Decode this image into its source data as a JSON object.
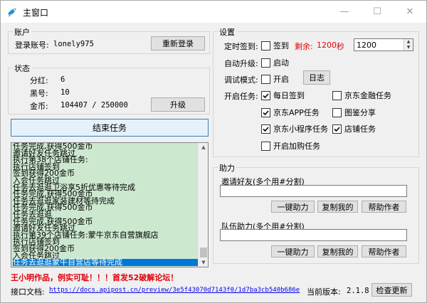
{
  "window": {
    "title": "主窗口",
    "minimize": "—",
    "maximize": "☐",
    "close": "✕"
  },
  "account": {
    "group_title": "账户",
    "login_label": "登录账号:",
    "login_value": "lonely975",
    "relogin_button": "重新登录"
  },
  "status": {
    "group_title": "状态",
    "dividend_label": "分红:",
    "dividend_value": "6",
    "blackno_label": "黑号:",
    "blackno_value": "10",
    "gold_label": "金币:",
    "gold_value": "104407 / 250000",
    "upgrade_button": "升级"
  },
  "end_task_button": "结束任务",
  "log": {
    "lines": [
      "任务完成,获得500金币",
      "邀请好友任务跳过",
      "执行第38个店铺任务:",
      "执行店铺签到",
      "签到获得200金币",
      "入会任务跳过",
      "任务去逛逛卫浴享5折优惠等待完成",
      "任务完成,获得500金币",
      "任务去逛逛家装建材等待完成",
      "任务完成,获得500金币",
      "任务去逛逛",
      "任务完成,获得500金币",
      "邀请好友任务跳过",
      "执行第39个店铺任务:蒙牛京东自营旗舰店",
      "执行店铺签到",
      "签到获得200金币",
      "入会任务跳过",
      "任务去逛逛蒙牛自营店等待完成"
    ],
    "selected_index": 17
  },
  "settings": {
    "group_title": "设置",
    "timer_label": "定时签到:",
    "timer_checkbox": "签到",
    "remaining_label": "剩余:",
    "remaining_value": "1200",
    "remaining_unit": "秒",
    "timer_input": "1200",
    "autoupgrade_label": "自动升级:",
    "autoupgrade_checkbox": "启动",
    "debug_label": "调试模式:",
    "debug_checkbox": "开启",
    "log_button": "日志",
    "tasks_label": "开启任务:",
    "tasks": [
      {
        "label": "每日签到",
        "checked": true
      },
      {
        "label": "京东金融任务",
        "checked": false
      },
      {
        "label": "京东APP任务",
        "checked": true
      },
      {
        "label": "图鉴分享",
        "checked": false
      },
      {
        "label": "京东小程序任务",
        "checked": true
      },
      {
        "label": "店铺任务",
        "checked": true
      },
      {
        "label": "开启加购任务",
        "checked": false
      }
    ]
  },
  "assist": {
    "group_title": "助力",
    "invite_label": "邀请好友(多个用#分割)",
    "invite_value": "",
    "team_label": "队伍助力(多个用#分割)",
    "team_value": "",
    "one_click": "一键助力",
    "copy_mine": "复制我的",
    "help_author": "帮助作者"
  },
  "footer": {
    "promo": "王小明作品，例实可耻！！！首发52破解论坛！",
    "api_label": "接口文档:",
    "api_link": "https://docs.apipost.cn/preview/3e5f43070d7143f0/1d7ba3cb540b686e",
    "version_label": "当前版本:",
    "version_value": "2.1.8",
    "check_update": "检查更新"
  },
  "colors": {
    "log_bg": "#cce8cf",
    "selected_line": "#0078d7",
    "remaining_red": "#e0000b",
    "promo_red": "#e0000b",
    "link_blue": "#0000ee"
  }
}
